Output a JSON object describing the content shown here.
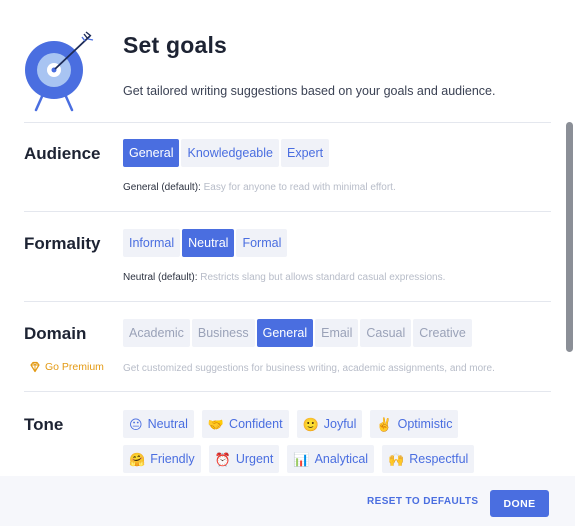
{
  "header": {
    "title": "Set goals",
    "subtitle": "Get tailored writing suggestions based on your goals and audience."
  },
  "audience": {
    "label": "Audience",
    "options": [
      "General",
      "Knowledgeable",
      "Expert"
    ],
    "selected": "General",
    "desc_lead": "General (default):",
    "desc_text": "Easy for anyone to read with minimal effort."
  },
  "formality": {
    "label": "Formality",
    "options": [
      "Informal",
      "Neutral",
      "Formal"
    ],
    "selected": "Neutral",
    "desc_lead": "Neutral (default):",
    "desc_text": "Restricts slang but allows standard casual expressions."
  },
  "domain": {
    "label": "Domain",
    "options": [
      "Academic",
      "Business",
      "General",
      "Email",
      "Casual",
      "Creative"
    ],
    "selected": "General",
    "premium_label": "Go Premium",
    "desc_text": "Get customized suggestions for business writing, academic assignments, and more."
  },
  "tone": {
    "label": "Tone",
    "rows": [
      [
        {
          "emoji": "😐",
          "label": "Neutral"
        },
        {
          "emoji": "🤝",
          "label": "Confident"
        },
        {
          "emoji": "🙂",
          "label": "Joyful"
        },
        {
          "emoji": "✌️",
          "label": "Optimistic"
        }
      ],
      [
        {
          "emoji": "🤗",
          "label": "Friendly"
        },
        {
          "emoji": "⏰",
          "label": "Urgent"
        },
        {
          "emoji": "📊",
          "label": "Analytical"
        },
        {
          "emoji": "🙌",
          "label": "Respectful"
        }
      ]
    ]
  },
  "footer": {
    "reset_label": "RESET TO DEFAULTS",
    "done_label": "DONE"
  },
  "colors": {
    "accent": "#4a6ee0",
    "premium": "#e39a14",
    "chip_bg": "#f0f2f8"
  }
}
